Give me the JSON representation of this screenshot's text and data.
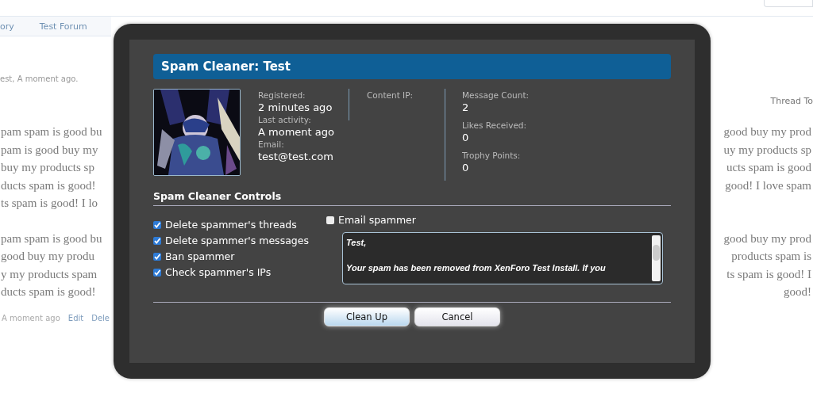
{
  "page": {
    "breadcrumbs": [
      {
        "label": "ory"
      },
      {
        "label": "Test Forum"
      }
    ],
    "byline": "est, A moment ago.",
    "thread_tools": "Thread To",
    "paragraphs": [
      [
        {
          "left": "pam spam is good bu",
          "right": "good buy my prod"
        },
        {
          "left": "pam is good buy my",
          "right": "uy my products sp"
        },
        {
          "left": "buy my products sp",
          "right": "ucts spam is good"
        },
        {
          "left": "ducts spam is good!",
          "right": "good! I love spam"
        },
        {
          "left": "ts spam is good! I lo"
        }
      ],
      [
        {
          "left": "pam spam is good bu",
          "right": "good buy my prod"
        },
        {
          "left": "good buy my produ",
          "right": "products spam is"
        },
        {
          "left": "y my products spam",
          "right": "ts spam is good! I"
        },
        {
          "left": "ducts spam is good!",
          "right": "good!"
        }
      ]
    ],
    "post_footer": {
      "time": "A moment ago",
      "links": [
        "Edit",
        "Dele"
      ]
    }
  },
  "dialog": {
    "title": "Spam Cleaner: Test",
    "info_columns": [
      [
        {
          "label": "Registered:",
          "value": "2 minutes ago"
        },
        {
          "label": "Last activity:",
          "value": "A moment ago"
        },
        {
          "label": "Email:",
          "value": "test@test.com"
        }
      ],
      [
        {
          "label": "Content IP:"
        }
      ],
      [
        {
          "label": "Message Count:",
          "value": "2"
        },
        {
          "label": "Likes Received:",
          "value": "0"
        },
        {
          "label": "Trophy Points:",
          "value": "0"
        }
      ]
    ],
    "controls": {
      "heading": "Spam Cleaner Controls",
      "options": [
        {
          "label": "Delete spammer's threads",
          "checked": true
        },
        {
          "label": "Delete spammer's messages",
          "checked": true
        },
        {
          "label": "Ban spammer",
          "checked": true
        },
        {
          "label": "Check spammer's IPs",
          "checked": true
        }
      ],
      "email": {
        "label": "Email spammer",
        "checked": false
      },
      "message": "Test,\n\nYour spam has been removed from XenForo Test Install. If you"
    },
    "buttons": [
      {
        "label": "Clean Up",
        "kind": "primary"
      },
      {
        "label": "Cancel",
        "kind": "secondary"
      }
    ]
  }
}
